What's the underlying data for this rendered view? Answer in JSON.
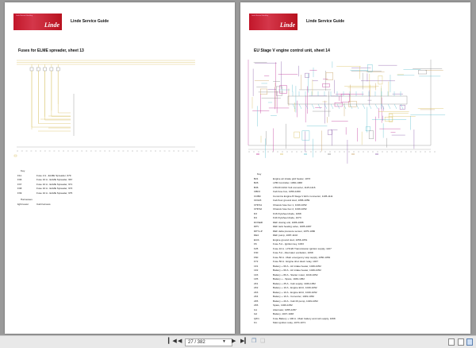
{
  "left_page": {
    "logo_tagline": "Linde Material Handling",
    "logo_brand": "Linde",
    "header": "Linde Service Guide",
    "title": "Fuses for ELME spreader, sheet 13",
    "key_title": "Key",
    "key": [
      {
        "code": "F11",
        "desc": "Fuse 2 A - ELME Spreader, 979"
      },
      {
        "code": "F36",
        "desc": "Fuse 10 A - ELME Spreader, 967"
      },
      {
        "code": "F37",
        "desc": "Fuse 10 A - ELME Spreader, 971"
      },
      {
        "code": "F38",
        "desc": "Fuse 10 A - ELME Spreader, 973"
      },
      {
        "code": "F39",
        "desc": "Fuse 10 A - ELME Spreader, 975"
      }
    ],
    "harness_title": "Harnesses",
    "harnesses": [
      {
        "code": "light tower",
        "desc": "Cab harness"
      }
    ]
  },
  "right_page": {
    "logo_tagline": "Linde Material Handling",
    "logo_brand": "Linde",
    "header": "Linde Service Guide",
    "title": "EU Stage V engine control unit, sheet 14",
    "key_title": "Key",
    "key": [
      {
        "code": "B21",
        "desc": "Engine air intake grid heater, 1073"
      },
      {
        "code": "B26",
        "desc": "LPM Controller, 1060-1068"
      },
      {
        "code": "B36",
        "desc": "LHC20 24/12 Volt converter, 1115-1116"
      },
      {
        "code": "CBF0",
        "desc": "Cab fuse box, 1059-1060"
      },
      {
        "code": "CCBD",
        "desc": "Cummins Engine B Stage V ECU connector, 1105-1111"
      },
      {
        "code": "CF023",
        "desc": "Cab floor ground stud, 1058-1059"
      },
      {
        "code": "CHFS1",
        "desc": "Chassis fuse box 1, 1049-1052"
      },
      {
        "code": "CHFS2",
        "desc": "Chassis fuse box 2, 1049-1052"
      },
      {
        "code": "D3",
        "desc": "K16 Flywheel diode, 1068"
      },
      {
        "code": "D4",
        "desc": "K44 Flywheel diode, 1073"
      },
      {
        "code": "DOSER",
        "desc": "DEF dosing unit, 1086-1088"
      },
      {
        "code": "DPV",
        "desc": "DEF tank heating valve, 1085-1087"
      },
      {
        "code": "DPT-LP",
        "desc": "DEF delta pressure sensor, 1075-1080"
      },
      {
        "code": "DE4",
        "desc": "DEF pump, 1087-1102"
      },
      {
        "code": "EGS",
        "desc": "Engine ground stud, 1056-1051"
      },
      {
        "code": "F6",
        "desc": "Fuse 5 A - Ignition key, 1063"
      },
      {
        "code": "F25",
        "desc": "Fuse 10 A - LHC20 Transmission ignition supply, 1107"
      },
      {
        "code": "F30",
        "desc": "Fuse 5 A - Alternator excitation, 1068"
      },
      {
        "code": "F60",
        "desc": "Fuse 50 A - Main emergency stop supply, 1050-1052"
      },
      {
        "code": "F72",
        "desc": "Fuse 50 A - Engine shut down relay, 1047"
      },
      {
        "code": "1F1",
        "desc": "Battery + 60 A - Air intake heater, 1049-1052"
      },
      {
        "code": "1F2",
        "desc": "Battery + 60 A - Air intake heater, 1049-1052"
      },
      {
        "code": "1F3",
        "desc": "Battery + 80 A - Starter motor, 1049-1052"
      },
      {
        "code": "1F5",
        "desc": "Battery + - Spare, 1049-1052"
      },
      {
        "code": "2F1",
        "desc": "Battery + 25 A - Cab supply, 1049-1052"
      },
      {
        "code": "2F2",
        "desc": "Battery + 10 A - Engine ECU, 1049-1052"
      },
      {
        "code": "2F3",
        "desc": "Battery + 10 A - Engine ECU, 1049-1052"
      },
      {
        "code": "2F4",
        "desc": "Battery + 10 A - Converter, 1049-1052"
      },
      {
        "code": "2F5",
        "desc": "Battery + 20 A - Cab lift pump, 1049-1052"
      },
      {
        "code": "2F6",
        "desc": "Spare, 1049-1052"
      },
      {
        "code": "G1",
        "desc": "Alternator, 1055-1057"
      },
      {
        "code": "G2",
        "desc": "Battery, 1047-1048"
      },
      {
        "code": "Q/F1",
        "desc": "Fuse Battery + 100 A - Main battery and cab supply, 1068"
      },
      {
        "code": "K1",
        "desc": "Main ignition relay, 1070-1071"
      }
    ]
  },
  "toolbar": {
    "first_icon": "first-page-icon",
    "prev_icon": "prev-page-icon",
    "page_value": "27 / 382",
    "next_icon": "next-page-icon",
    "last_icon": "last-page-icon"
  },
  "colors": {
    "brand_red": "#c2162a",
    "wire_yellow": "#d8c060",
    "wire_magenta": "#c0389a",
    "wire_cyan": "#60c0d0",
    "wire_gray": "#888888"
  }
}
